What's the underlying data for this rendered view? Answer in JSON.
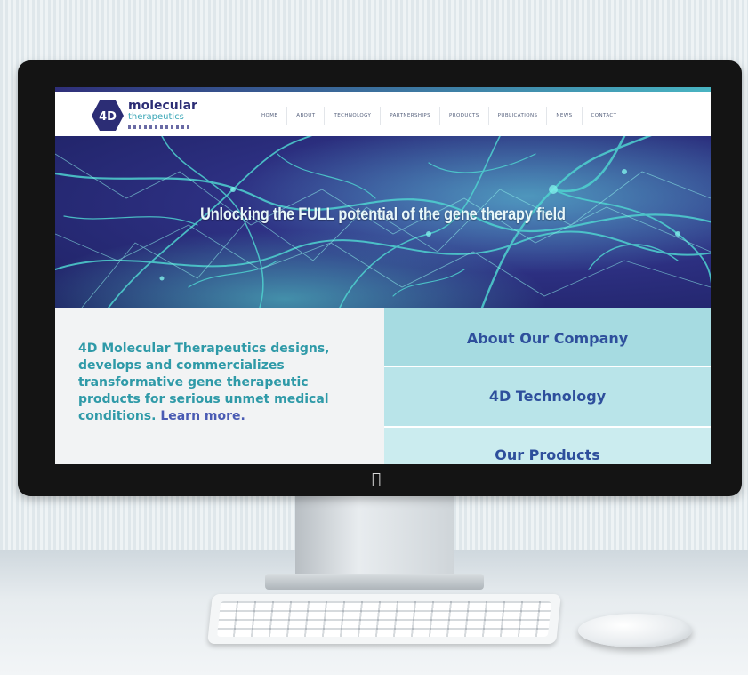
{
  "site": {
    "logo": {
      "mark": "4D",
      "name": "molecular",
      "tagline": "therapeutics"
    },
    "nav": [
      "HOME",
      "ABOUT",
      "TECHNOLOGY",
      "PARTNERSHIPS",
      "PRODUCTS",
      "PUBLICATIONS",
      "NEWS",
      "CONTACT"
    ],
    "hero": {
      "title": "Unlocking the FULL potential of the gene therapy field"
    },
    "intro": {
      "text": "4D Molecular Therapeutics designs, develops and commercializes transformative gene therapeutic products for serious unmet medical conditions.",
      "link": "Learn more."
    },
    "tiles": [
      "About Our Company",
      "4D Technology",
      "Our Products"
    ]
  },
  "colors": {
    "brand_navy": "#2c2d75",
    "brand_teal": "#3aa6b6",
    "hero_bg": "#2a2d7c",
    "intro_text": "#2f9aa8",
    "tile_text": "#2e4f9c"
  },
  "icons": {
    "logo": "hexagon-4d-logo",
    "device": "apple-logo-icon"
  }
}
